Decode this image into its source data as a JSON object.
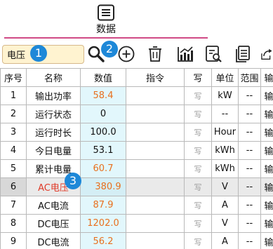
{
  "top_tab": {
    "label": "数据",
    "icon": "menu-icon"
  },
  "search": {
    "value": "电压"
  },
  "toolbar": {
    "buttons": [
      "search-icon",
      "add-icon",
      "delete-icon",
      "chart-icon",
      "inspect-icon",
      "document-icon",
      "export-icon"
    ]
  },
  "badges": [
    "1",
    "2",
    "3"
  ],
  "table": {
    "headers": [
      "序号",
      "名称",
      "数值",
      "指令",
      "写",
      "单位",
      "范围",
      "输"
    ],
    "rows": [
      {
        "idx": "1",
        "name": "输出功率",
        "value": "58.4",
        "write": "写",
        "unit": "kW",
        "range": "--",
        "extra": "输"
      },
      {
        "idx": "2",
        "name": "运行状态",
        "value": "0",
        "write": "写",
        "unit": "--",
        "range": "--",
        "extra": "输"
      },
      {
        "idx": "3",
        "name": "运行时长",
        "value": "100.0",
        "write": "写",
        "unit": "Hour",
        "range": "--",
        "extra": "输"
      },
      {
        "idx": "4",
        "name": "今日电量",
        "value": "53.1",
        "write": "写",
        "unit": "kWh",
        "range": "--",
        "extra": "输"
      },
      {
        "idx": "5",
        "name": "累计电量",
        "value": "60.7",
        "write": "写",
        "unit": "kWh",
        "range": "--",
        "extra": "输"
      },
      {
        "idx": "6",
        "name": "AC电压",
        "value": "380.9",
        "write": "写",
        "unit": "V",
        "range": "--",
        "extra": "输"
      },
      {
        "idx": "7",
        "name": "AC电流",
        "value": "87.9",
        "write": "写",
        "unit": "A",
        "range": "--",
        "extra": "输"
      },
      {
        "idx": "8",
        "name": "DC电压",
        "value": "1202.0",
        "write": "写",
        "unit": "V",
        "range": "--",
        "extra": "输"
      },
      {
        "idx": "9",
        "name": "DC电流",
        "value": "56.2",
        "write": "写",
        "unit": "A",
        "range": "--",
        "extra": "输"
      }
    ]
  },
  "colors": {
    "value_text": "#e8701e",
    "value_bg": "#e2f7fc",
    "accent_line": "#d04a86",
    "badge": "#1e88d8",
    "search_bg": "#fff3d0",
    "selected_name": "#e03a28"
  }
}
